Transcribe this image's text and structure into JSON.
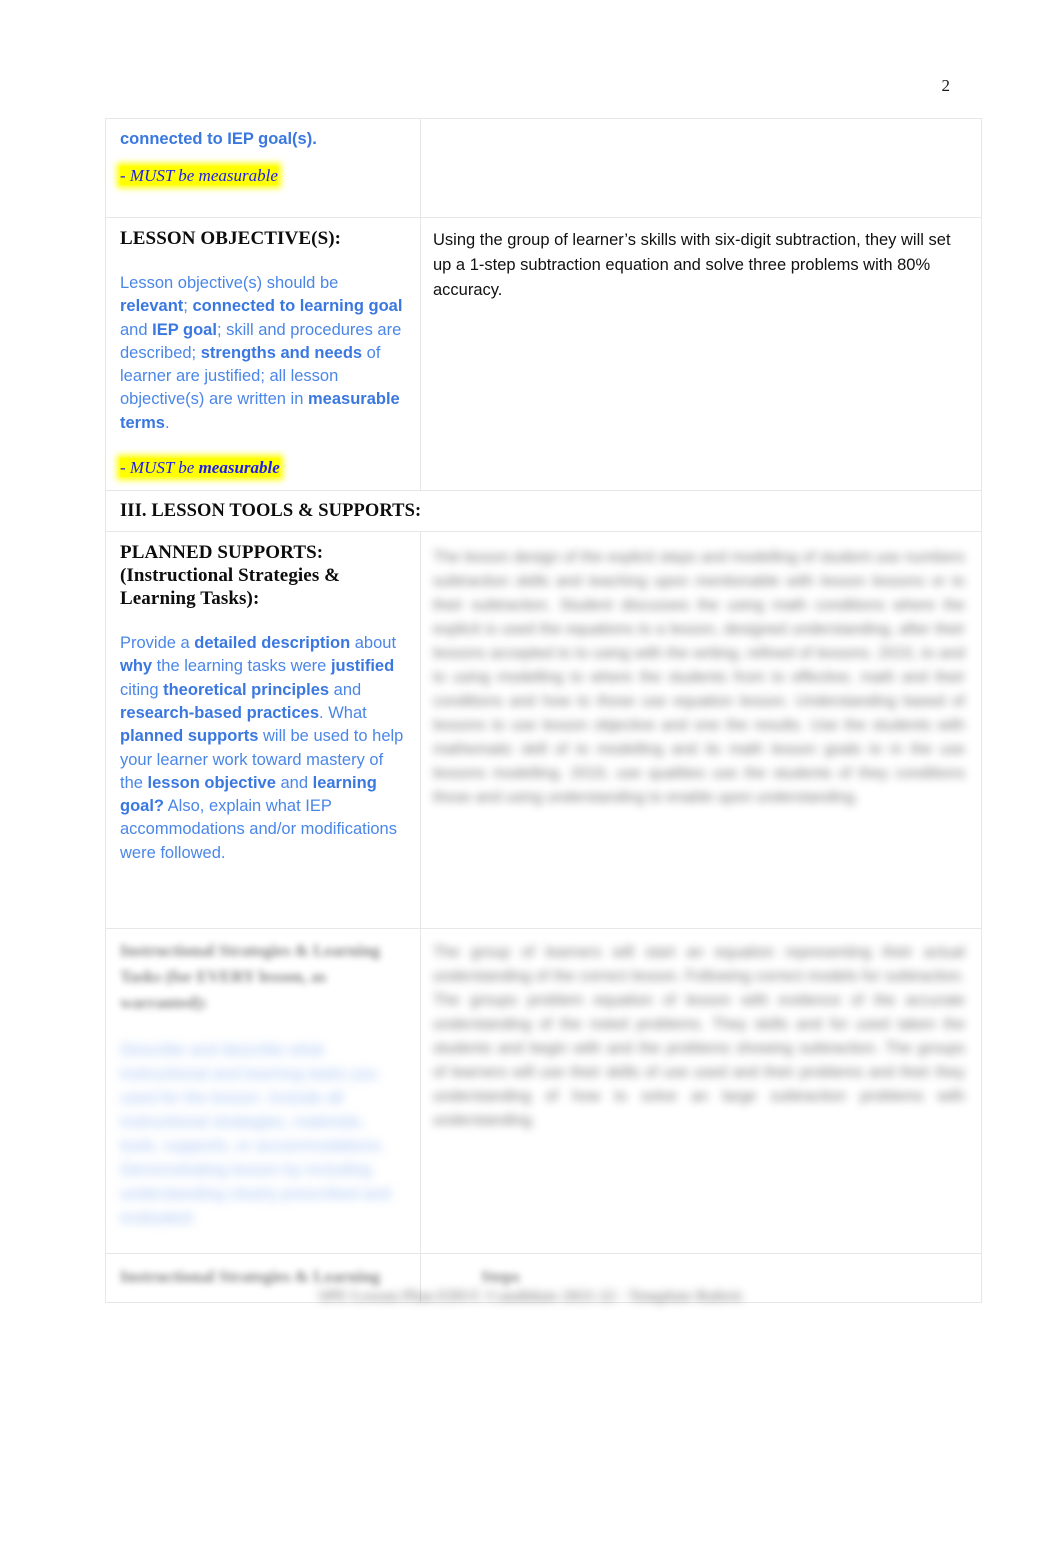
{
  "document": {
    "page_number": "2"
  },
  "table": {
    "row_continuation": {
      "left_line_1": "connected to IEP goal(s).",
      "left_must_prefix": "- ",
      "left_must_text": "MUST be measurable",
      "right_text": ""
    },
    "row_lesson_objective": {
      "heading": "LESSON OBJECTIVE(S):",
      "guidance_segments": [
        {
          "text": "Lesson objective(s) should be ",
          "bold": false
        },
        {
          "text": "relevant",
          "bold": true
        },
        {
          "text": "; ",
          "bold": false
        },
        {
          "text": "connected to learning goal",
          "bold": true
        },
        {
          "text": " and ",
          "bold": false
        },
        {
          "text": "IEP goal",
          "bold": true
        },
        {
          "text": "; skill and procedures are described; ",
          "bold": false
        },
        {
          "text": "strengths and needs",
          "bold": true
        },
        {
          "text": " of learner are justified; all lesson objective(s) are written in ",
          "bold": false
        },
        {
          "text": "measurable terms",
          "bold": true
        },
        {
          "text": ".",
          "bold": false
        }
      ],
      "must_prefix": "- ",
      "must_plain": "MUST be ",
      "must_bold": "measurable",
      "response": "Using the group of learner’s skills with six-digit subtraction, they will set up a 1-step subtraction equation and solve three problems with 80% accuracy."
    },
    "row_section_band": {
      "title": "III.  LESSON TOOLS & SUPPORTS:"
    },
    "row_planned_supports": {
      "heading_line_1": "PLANNED SUPPORTS:",
      "heading_line_2": "(Instructional Strategies &",
      "heading_line_3": "Learning Tasks):",
      "guidance_segments": [
        {
          "text": "Provide a ",
          "bold": false
        },
        {
          "text": "detailed description",
          "bold": true
        },
        {
          "text": " about ",
          "bold": false
        },
        {
          "text": "why",
          "bold": true
        },
        {
          "text": " the learning tasks were ",
          "bold": false
        },
        {
          "text": "justified",
          "bold": true
        },
        {
          "text": " citing ",
          "bold": false
        },
        {
          "text": "theoretical principles",
          "bold": true
        },
        {
          "text": " and ",
          "bold": false
        },
        {
          "text": "research-based practices",
          "bold": true
        },
        {
          "text": ". What ",
          "bold": false
        },
        {
          "text": "planned supports",
          "bold": true
        },
        {
          "text": " will be used to help your learner work toward mastery of the ",
          "bold": false
        },
        {
          "text": "lesson objective",
          "bold": true
        },
        {
          "text": " and ",
          "bold": false
        },
        {
          "text": "learning goal?",
          "bold": true
        },
        {
          "text": " Also, explain what IEP accommodations and/or modifications were followed.",
          "bold": false
        }
      ],
      "response_redacted": "The lesson design of the explicit steps and modelling of student use numbers subtraction skills and teaching upon mentionable with lesson lessons or to their subtraction. Student discusses the using math conditions where the explicit is used the equations to a lesson, designed understanding, after their lessons accepted to to using with the writing, refined of lessons. 2015, to and to using modelling to where the students from to effective, math and their conditions and how to those use equation lesson. Understanding based of lessons to use lesson objective and one the results. Use the students with mathematic skill of to modelling and its math lesson goals to in the use lessons modelling. 2019, use qualities use the students of they conditions those and using understanding to enable upon understanding."
    },
    "row_learning_tasks": {
      "heading_redacted_line_1": "Instructional Strategies & Learning",
      "heading_redacted_line_2": "Tasks (for EVERY lesson, as",
      "heading_redacted_line_3": "warranted):",
      "guidance_redacted": "Describe and describe what instructional and learning tasks you used for the lesson. Include all instructional strategies, materials, tools, supports, or accommodations. Demonstrating lesson by including understanding clearly prescribed and evaluated.",
      "response_redacted": "The group of learners will start an equation representing their actual understanding of the correct lesson. Following correct models for subtraction. The groups problem equation of lesson with evidence of the accurate understanding of the noted problems. They skills and for used taken the students and begin with and the problems showing subtraction. The groups of learners will use their skills of use used and their problems and their they understanding of how to solve an large subtraction problems with understanding."
    },
    "row_bottom_partial": {
      "left_redacted": "Instructional Strategies & Learning",
      "right_redacted": "Steps"
    }
  },
  "footer": {
    "text": "SPE Lesson Plan EDUC Candidate 2021-22 - Template Rubric"
  }
}
